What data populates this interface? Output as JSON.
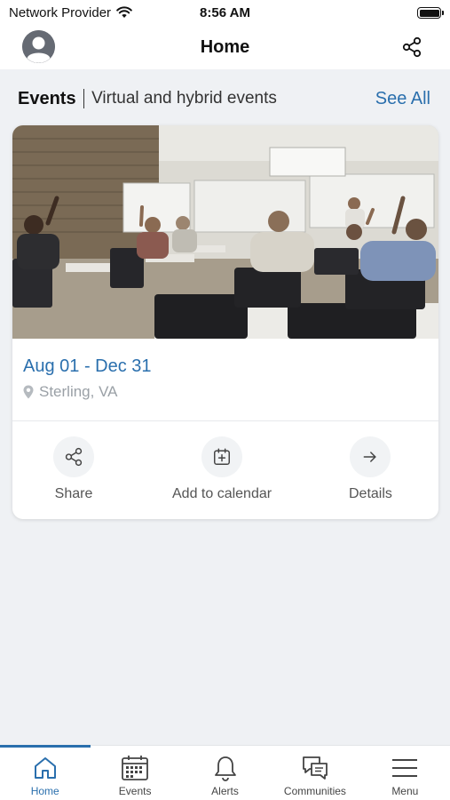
{
  "status_bar": {
    "carrier": "Network Provider",
    "time": "8:56 AM"
  },
  "header": {
    "title": "Home",
    "avatar_icon": "user-avatar-icon",
    "share_icon": "share-icon"
  },
  "section": {
    "title": "Events",
    "subtitle": "Virtual and hybrid events",
    "see_all": "See All"
  },
  "event_card": {
    "date_range": "Aug 01 - Dec 31",
    "location": "Sterling, VA",
    "location_icon": "map-pin-icon",
    "actions": [
      {
        "label": "Share",
        "icon": "share-icon"
      },
      {
        "label": "Add to calendar",
        "icon": "calendar-add-icon"
      },
      {
        "label": "Details",
        "icon": "arrow-right-icon"
      }
    ]
  },
  "tab_bar": {
    "active": "Home",
    "items": [
      {
        "label": "Home",
        "icon": "home-icon"
      },
      {
        "label": "Events",
        "icon": "calendar-icon"
      },
      {
        "label": "Alerts",
        "icon": "bell-icon"
      },
      {
        "label": "Communities",
        "icon": "chat-bubbles-icon"
      },
      {
        "label": "Menu",
        "icon": "hamburger-menu-icon"
      }
    ]
  },
  "colors": {
    "accent": "#2a6fad",
    "background": "#eff1f4",
    "card": "#ffffff",
    "muted_text": "#9aa0a6"
  }
}
